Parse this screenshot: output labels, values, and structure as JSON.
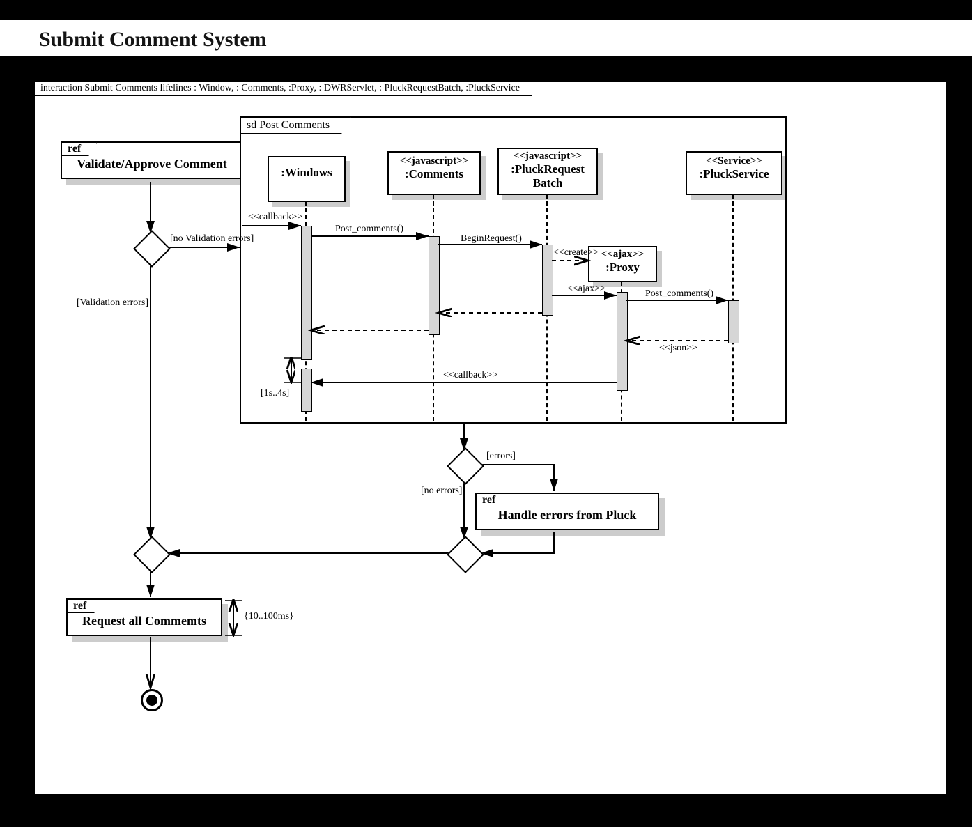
{
  "title": "Submit Comment System",
  "outer_tab": "interaction Submit Comments lifelines : Window, : Comments, :Proxy, : DWRServlet, : PluckRequestBatch, :PluckService",
  "ref1": {
    "tab": "ref",
    "label": "Validate/Approve Comment"
  },
  "ref2": {
    "tab": "ref",
    "label": "Handle errors from Pluck"
  },
  "ref3": {
    "tab": "ref",
    "label": "Request all Commemts"
  },
  "inner_tab": "sd Post Comments",
  "lifelines": {
    "windows": {
      "stereo": "",
      "name": ":Windows"
    },
    "comments": {
      "stereo": "<<javascript>>",
      "name": ":Comments"
    },
    "pluckreq": {
      "stereo": "<<javascript>>",
      "name": ":PluckRequest",
      "name2": "Batch"
    },
    "proxy": {
      "stereo": "<<ajax>>",
      "name": ":Proxy"
    },
    "pluckservice": {
      "stereo": "<<Service>>",
      "name": ":PluckService"
    }
  },
  "guards": {
    "no_validation": "[no Validation errors]",
    "validation": "[Validation errors]",
    "errors": "[errors]",
    "no_errors": "[no errors]"
  },
  "messages": {
    "callback1": "<<callback>>",
    "post_comments1": "Post_comments()",
    "begin_request": "BeginRequest()",
    "create": "<<create>>",
    "ajax": "<<ajax>>",
    "post_comments2": "Post_comments()",
    "json": "<<json>>",
    "callback2": "<<callback>>"
  },
  "durations": {
    "d1": "[1s..4s]",
    "d2": "{10..100ms}"
  }
}
